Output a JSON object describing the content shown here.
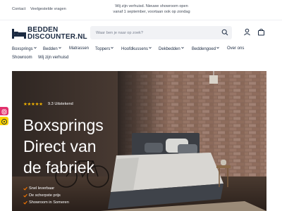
{
  "topbar": {
    "links": [
      "Contact",
      "Veelgestelde vragen"
    ],
    "notice_line1": "Wij zijn verhuisd. Nieuwe showroom open",
    "notice_line2": "vanaf 1 september, voortaan ook op zondag"
  },
  "logo": {
    "line1": "BEDDEN",
    "line2": "DISCOUNTER.NL"
  },
  "search": {
    "placeholder": "Waar ben je naar op zoek?"
  },
  "header_icons": [
    "search-icon",
    "user-icon",
    "cart-icon"
  ],
  "nav": {
    "row1": [
      {
        "label": "Boxsprings",
        "dropdown": true
      },
      {
        "label": "Bedden",
        "dropdown": true
      },
      {
        "label": "Matrassen",
        "dropdown": false
      },
      {
        "label": "Toppers",
        "dropdown": true
      },
      {
        "label": "Hoofdkussens",
        "dropdown": true
      },
      {
        "label": "Dekbedden",
        "dropdown": true
      },
      {
        "label": "Beddengoed",
        "dropdown": true
      },
      {
        "label": "Over ons",
        "dropdown": false
      }
    ],
    "row2": [
      {
        "label": "Showroom",
        "dropdown": false
      },
      {
        "label": "Wij zijn verhuisd",
        "dropdown": false
      }
    ]
  },
  "hero": {
    "rating_stars": "★★★★★",
    "rating_text": "9.3 Uitstekend",
    "headline": [
      "Boxsprings",
      "Direct van",
      "de fabriek"
    ],
    "usps": [
      "Snel leverbaar",
      "De scherpste prijs",
      "Showroom in Someren"
    ]
  },
  "social": [
    "instagram-icon",
    "reviews-badge-icon"
  ],
  "colors": {
    "navy": "#1b2a41",
    "star": "#f4b400",
    "check": "#ff7a00",
    "instagram": "#e1306c",
    "badge": "#ffd400"
  }
}
